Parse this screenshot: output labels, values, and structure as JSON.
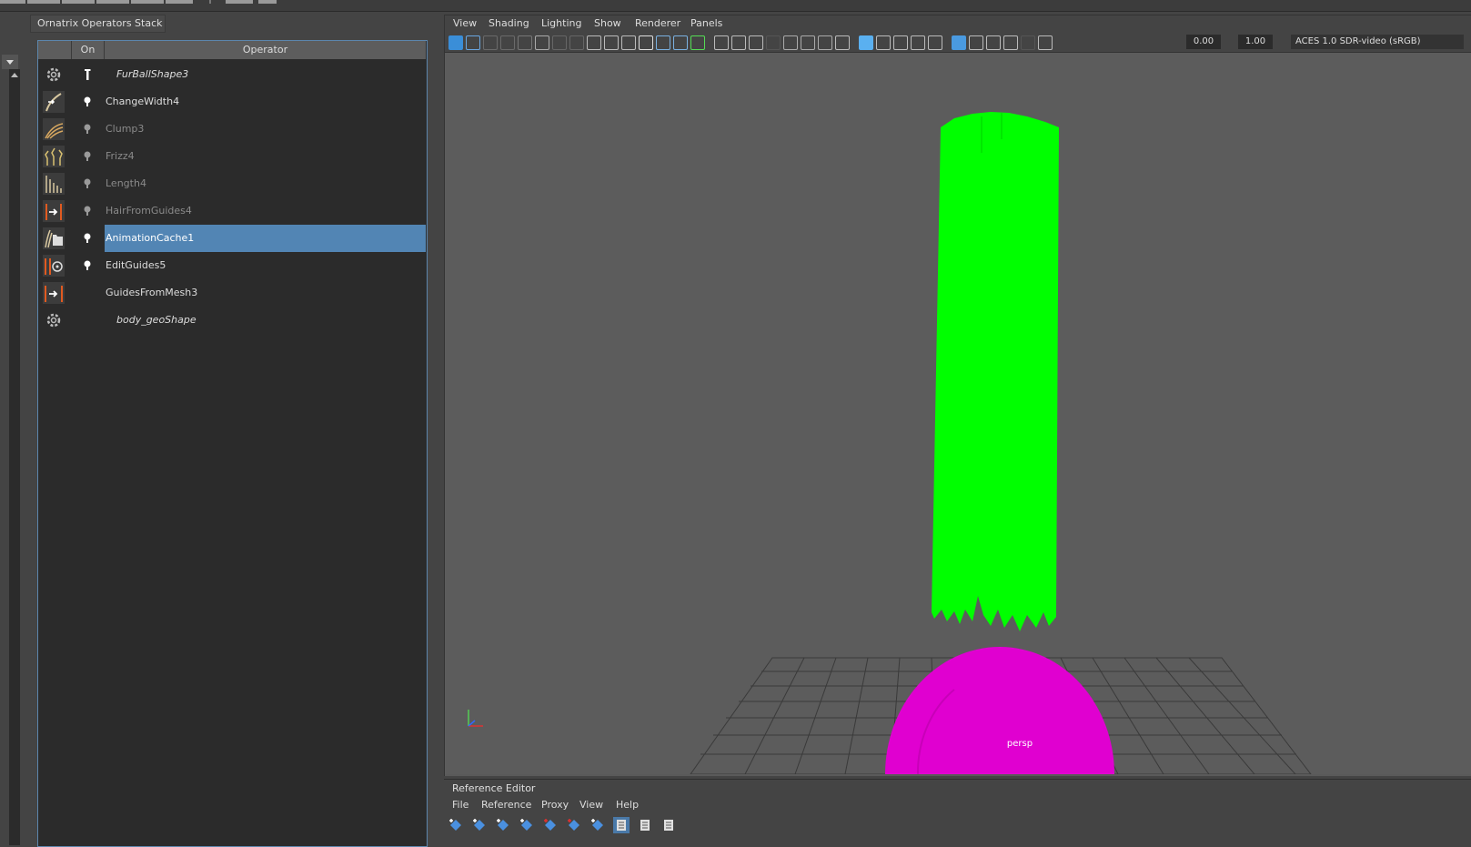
{
  "ornatrix": {
    "tab_title": "Ornatrix Operators Stack",
    "columns": {
      "on": "On",
      "operator": "Operator"
    },
    "rows": [
      {
        "label": "FurBallShape3",
        "icon": "gear-icon",
        "toggle": "pin",
        "style": "italic",
        "selected": false
      },
      {
        "label": "ChangeWidth4",
        "icon": "change-width-icon",
        "toggle": "on",
        "style": "normal",
        "selected": false
      },
      {
        "label": "Clump3",
        "icon": "clump-icon",
        "toggle": "off",
        "style": "dim",
        "selected": false
      },
      {
        "label": "Frizz4",
        "icon": "frizz-icon",
        "toggle": "off",
        "style": "dim",
        "selected": false
      },
      {
        "label": "Length4",
        "icon": "length-icon",
        "toggle": "off",
        "style": "dim",
        "selected": false
      },
      {
        "label": "HairFromGuides4",
        "icon": "hair-from-guides-icon",
        "toggle": "off",
        "style": "dim",
        "selected": false
      },
      {
        "label": "AnimationCache1",
        "icon": "animation-cache-icon",
        "toggle": "on",
        "style": "normal",
        "selected": true
      },
      {
        "label": "EditGuides5",
        "icon": "edit-guides-icon",
        "toggle": "on",
        "style": "normal",
        "selected": false
      },
      {
        "label": "GuidesFromMesh3",
        "icon": "guides-from-mesh-icon",
        "toggle": "none",
        "style": "normal",
        "selected": false
      },
      {
        "label": "body_geoShape",
        "icon": "gear-icon",
        "toggle": "none",
        "style": "italic",
        "selected": false
      }
    ]
  },
  "viewport": {
    "menu": [
      "View",
      "Shading",
      "Lighting",
      "Show",
      "Renderer",
      "Panels"
    ],
    "exposure": "0.00",
    "gamma": "1.00",
    "color_space": "ACES 1.0 SDR-video (sRGB)",
    "camera_label": "persp",
    "colors": {
      "hair": "#00ff00",
      "sphere": "#e000d0",
      "grid": "#3a3a3a",
      "background": "#5c5c5c"
    }
  },
  "reference_editor": {
    "title": "Reference Editor",
    "menu": [
      "File",
      "Reference",
      "Proxy",
      "View",
      "Help"
    ]
  }
}
